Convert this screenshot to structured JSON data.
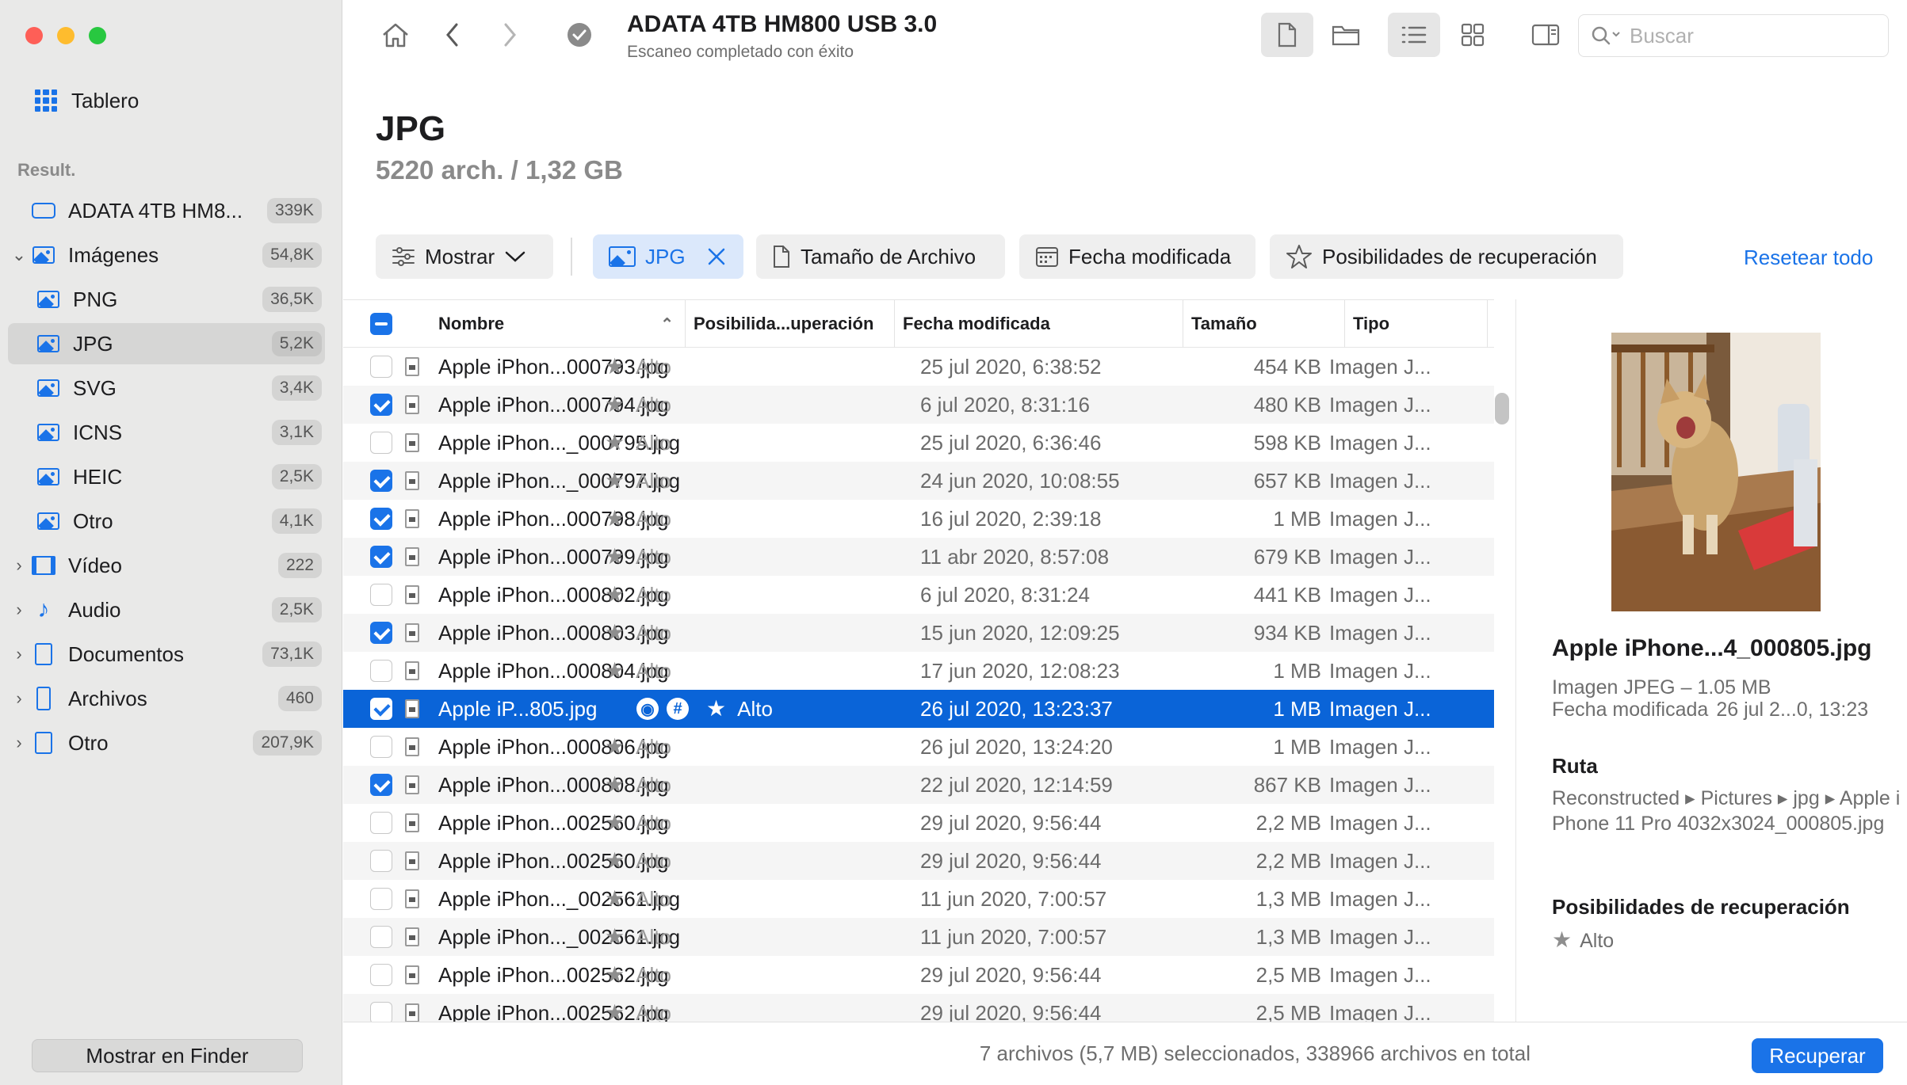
{
  "sidebar": {
    "dashboard_label": "Tablero",
    "section_label": "Result.",
    "items": [
      {
        "label": "ADATA 4TB HM8...",
        "count": "339K"
      },
      {
        "label": "Imágenes",
        "count": "54,8K"
      },
      {
        "label": "PNG",
        "count": "36,5K"
      },
      {
        "label": "JPG",
        "count": "5,2K"
      },
      {
        "label": "SVG",
        "count": "3,4K"
      },
      {
        "label": "ICNS",
        "count": "3,1K"
      },
      {
        "label": "HEIC",
        "count": "2,5K"
      },
      {
        "label": "Otro",
        "count": "4,1K"
      },
      {
        "label": "Vídeo",
        "count": "222"
      },
      {
        "label": "Audio",
        "count": "2,5K"
      },
      {
        "label": "Documentos",
        "count": "73,1K"
      },
      {
        "label": "Archivos",
        "count": "460"
      },
      {
        "label": "Otro",
        "count": "207,9K"
      }
    ],
    "finder_button": "Mostrar en Finder"
  },
  "toolbar": {
    "title": "ADATA 4TB HM800 USB 3.0",
    "subtitle": "Escaneo completado con éxito",
    "search_placeholder": "Buscar"
  },
  "heading": {
    "title": "JPG",
    "subtitle": "5220 arch. / 1,32 GB"
  },
  "filters": {
    "show": "Mostrar",
    "active": "JPG",
    "size": "Tamaño de Archivo",
    "date": "Fecha modificada",
    "chances": "Posibilidades de recuperación",
    "reset": "Resetear todo"
  },
  "table": {
    "columns": [
      "Nombre",
      "Posibilida...uperación",
      "Fecha modificada",
      "Tamaño",
      "Tipo"
    ],
    "rows": [
      {
        "name": "Apple iPhon...000793.jpg",
        "chance": "Alto",
        "date": "25 jul 2020, 6:38:52",
        "size": "454 KB",
        "type": "Imagen J...",
        "checked": false
      },
      {
        "name": "Apple iPhon...000794.jpg",
        "chance": "Alto",
        "date": "6 jul 2020, 8:31:16",
        "size": "480 KB",
        "type": "Imagen J...",
        "checked": true
      },
      {
        "name": "Apple iPhon..._000795.jpg",
        "chance": "Alto",
        "date": "25 jul 2020, 6:36:46",
        "size": "598 KB",
        "type": "Imagen J...",
        "checked": false
      },
      {
        "name": "Apple iPhon..._000797.jpg",
        "chance": "Alto",
        "date": "24 jun 2020, 10:08:55",
        "size": "657 KB",
        "type": "Imagen J...",
        "checked": true
      },
      {
        "name": "Apple iPhon...000798.jpg",
        "chance": "Alto",
        "date": "16 jul 2020, 2:39:18",
        "size": "1 MB",
        "type": "Imagen J...",
        "checked": true
      },
      {
        "name": "Apple iPhon...000799.jpg",
        "chance": "Alto",
        "date": "11 abr 2020, 8:57:08",
        "size": "679 KB",
        "type": "Imagen J...",
        "checked": true
      },
      {
        "name": "Apple iPhon...000802.jpg",
        "chance": "Alto",
        "date": "6 jul 2020, 8:31:24",
        "size": "441 KB",
        "type": "Imagen J...",
        "checked": false
      },
      {
        "name": "Apple iPhon...000803.jpg",
        "chance": "Alto",
        "date": "15 jun 2020, 12:09:25",
        "size": "934 KB",
        "type": "Imagen J...",
        "checked": true
      },
      {
        "name": "Apple iPhon...000804.jpg",
        "chance": "Alto",
        "date": "17 jun 2020, 12:08:23",
        "size": "1 MB",
        "type": "Imagen J...",
        "checked": false
      },
      {
        "name": "Apple iP...805.jpg",
        "chance": "Alto",
        "date": "26 jul 2020, 13:23:37",
        "size": "1 MB",
        "type": "Imagen J...",
        "checked": true,
        "selected": true
      },
      {
        "name": "Apple iPhon...000806.jpg",
        "chance": "Alto",
        "date": "26 jul 2020, 13:24:20",
        "size": "1 MB",
        "type": "Imagen J...",
        "checked": false
      },
      {
        "name": "Apple iPhon...000808.jpg",
        "chance": "Alto",
        "date": "22 jul 2020, 12:14:59",
        "size": "867 KB",
        "type": "Imagen J...",
        "checked": true
      },
      {
        "name": "Apple iPhon...002560.jpg",
        "chance": "Alto",
        "date": "29 jul 2020, 9:56:44",
        "size": "2,2 MB",
        "type": "Imagen J...",
        "checked": false
      },
      {
        "name": "Apple iPhon...002560.jpg",
        "chance": "Alto",
        "date": "29 jul 2020, 9:56:44",
        "size": "2,2 MB",
        "type": "Imagen J...",
        "checked": false
      },
      {
        "name": "Apple iPhon..._002561.jpg",
        "chance": "Alto",
        "date": "11 jun 2020, 7:00:57",
        "size": "1,3 MB",
        "type": "Imagen J...",
        "checked": false
      },
      {
        "name": "Apple iPhon..._002561.jpg",
        "chance": "Alto",
        "date": "11 jun 2020, 7:00:57",
        "size": "1,3 MB",
        "type": "Imagen J...",
        "checked": false
      },
      {
        "name": "Apple iPhon...002562.jpg",
        "chance": "Alto",
        "date": "29 jul 2020, 9:56:44",
        "size": "2,5 MB",
        "type": "Imagen J...",
        "checked": false
      },
      {
        "name": "Apple iPhon...002562.jpg",
        "chance": "Alto",
        "date": "29 jul 2020, 9:56:44",
        "size": "2,5 MB",
        "type": "Imagen J...",
        "checked": false
      }
    ]
  },
  "preview": {
    "title": "Apple iPhone...4_000805.jpg",
    "kind": "Imagen JPEG – 1.05 MB",
    "modified_label": "Fecha modificada",
    "modified_value": "26 jul 2...0, 13:23",
    "path_heading": "Ruta",
    "path": "Reconstructed ▸ Pictures ▸ jpg ▸ Apple iPhone 11 Pro 4032x3024_000805.jpg",
    "chances_heading": "Posibilidades de recuperación",
    "chances_value": "Alto"
  },
  "footer": {
    "status": "7 archivos (5,7 MB) seleccionados, 338966 archivos en total",
    "recover": "Recuperar"
  },
  "colors": {
    "accent": "#1a73e8",
    "selection": "#0a64d8",
    "sidebar": "#e9e9e8"
  }
}
